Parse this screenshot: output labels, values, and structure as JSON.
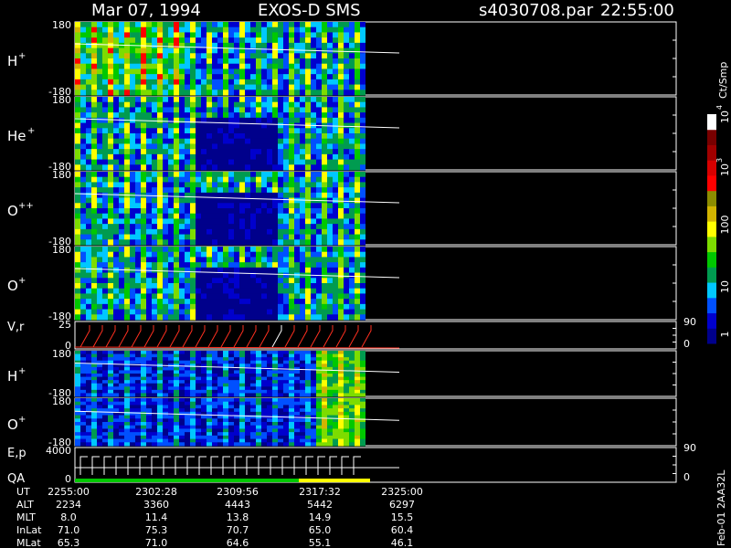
{
  "header": {
    "date": "Mar 07, 1994",
    "instrument": "EXOS-D SMS",
    "file": "s4030708.par",
    "time": "22:55:00"
  },
  "panels": [
    {
      "id": "h-plus",
      "label": "H",
      "sup": "+",
      "top": "180",
      "bottom": "-180"
    },
    {
      "id": "he-plus",
      "label": "He",
      "sup": "+",
      "top": "180",
      "bottom": "-180"
    },
    {
      "id": "o-pp",
      "label": "O",
      "sup": "++",
      "top": "180",
      "bottom": "-180"
    },
    {
      "id": "o-plus",
      "label": "O",
      "sup": "+",
      "top": "180",
      "bottom": "-180"
    },
    {
      "id": "vr",
      "label": "V,r",
      "sup": "",
      "top": "25",
      "bottom": "0",
      "right_top": "90",
      "right_bottom": "0"
    },
    {
      "id": "h-plus-2",
      "label": "H",
      "sup": "+",
      "top": "180",
      "bottom": "-180"
    },
    {
      "id": "o-plus-2",
      "label": "O",
      "sup": "+",
      "top": "180",
      "bottom": "-180"
    },
    {
      "id": "ep",
      "label": "E,p",
      "sup": "",
      "top": "4000",
      "bottom": "0",
      "right_top": "90",
      "right_bottom": "0",
      "sublabel": "QA"
    }
  ],
  "colorbar": {
    "unit": "Ct/Smp",
    "ticks": [
      "1",
      "10",
      "100",
      "10",
      "10"
    ],
    "tick_sups": [
      "",
      "",
      "",
      "3",
      "4"
    ],
    "colors": [
      "#00008b",
      "#0000cd",
      "#0050ff",
      "#00c8ff",
      "#009b50",
      "#00c800",
      "#7ddc00",
      "#ffff00",
      "#d2b400",
      "#8c8c00",
      "#ff0000",
      "#d70000",
      "#a00000",
      "#780000",
      "#ffffff"
    ]
  },
  "footer": {
    "rows": [
      {
        "label": "UT",
        "values": [
          "2255:00",
          "2302:28",
          "2309:56",
          "2317:32",
          "2325:00"
        ]
      },
      {
        "label": "ALT",
        "values": [
          "2234",
          "3360",
          "4443",
          "5442",
          "6297"
        ]
      },
      {
        "label": "MLT",
        "values": [
          "8.0",
          "11.4",
          "13.8",
          "14.9",
          "15.5"
        ]
      },
      {
        "label": "InLat",
        "values": [
          "71.0",
          "75.3",
          "70.7",
          "65.0",
          "60.4"
        ]
      },
      {
        "label": "MLat",
        "values": [
          "65.3",
          "71.0",
          "64.6",
          "55.1",
          "46.1"
        ]
      }
    ],
    "stamp": "Feb-01 2AA32L"
  },
  "chart_data": {
    "type": "heatmap",
    "title": "Mar 07, 1994   EXOS-D SMS",
    "x_ticks": [
      "2255:00",
      "2302:28",
      "2309:56",
      "2317:32",
      "2325:00"
    ],
    "data_extent_fraction_of_axis": 0.485,
    "series": [
      {
        "name": "H+",
        "ylim": [
          -180,
          180
        ]
      },
      {
        "name": "He+",
        "ylim": [
          -180,
          180
        ]
      },
      {
        "name": "O++",
        "ylim": [
          -180,
          180
        ]
      },
      {
        "name": "O+",
        "ylim": [
          -180,
          180
        ]
      },
      {
        "name": "V,r",
        "ylim": [
          0,
          25
        ],
        "right_ylim": [
          0,
          90
        ]
      },
      {
        "name": "H+",
        "ylim": [
          -180,
          180
        ]
      },
      {
        "name": "O+",
        "ylim": [
          -180,
          180
        ]
      },
      {
        "name": "E,p",
        "ylim": [
          0,
          4000
        ],
        "right_ylim": [
          0,
          90
        ]
      }
    ],
    "colorbar_range": [
      1,
      10000
    ],
    "colorbar_scale": "log",
    "colorbar_unit": "Ct/Smp"
  }
}
